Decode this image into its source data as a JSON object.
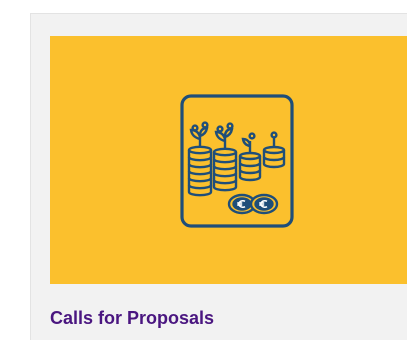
{
  "card": {
    "title": "Calls for Proposals",
    "banner_color": "#fbc02d",
    "title_color": "#4a1680",
    "icon": "funding-coins-plants-icon",
    "icon_color": "#1f4e79"
  }
}
